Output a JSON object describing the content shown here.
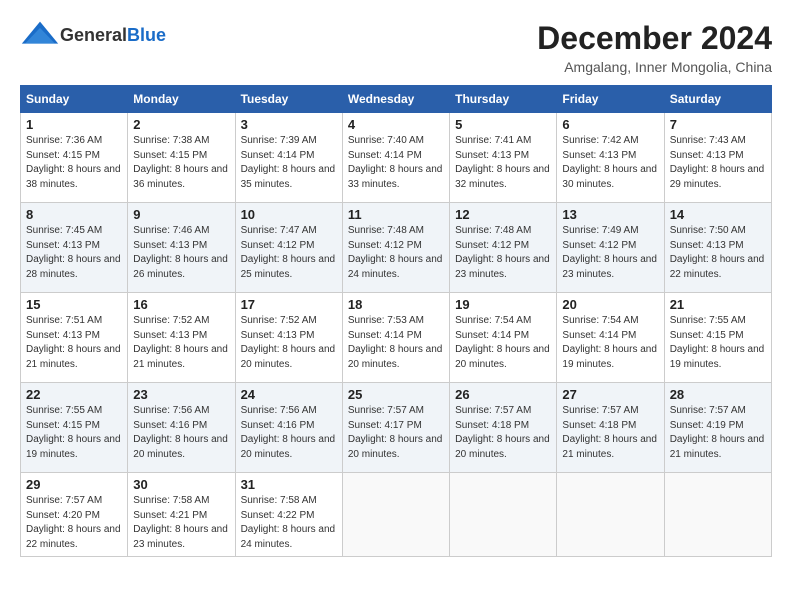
{
  "header": {
    "logo_general": "General",
    "logo_blue": "Blue",
    "month": "December 2024",
    "location": "Amgalang, Inner Mongolia, China"
  },
  "days_of_week": [
    "Sunday",
    "Monday",
    "Tuesday",
    "Wednesday",
    "Thursday",
    "Friday",
    "Saturday"
  ],
  "weeks": [
    [
      {
        "day": "1",
        "sunrise": "7:36 AM",
        "sunset": "4:15 PM",
        "daylight": "8 hours and 38 minutes."
      },
      {
        "day": "2",
        "sunrise": "7:38 AM",
        "sunset": "4:15 PM",
        "daylight": "8 hours and 36 minutes."
      },
      {
        "day": "3",
        "sunrise": "7:39 AM",
        "sunset": "4:14 PM",
        "daylight": "8 hours and 35 minutes."
      },
      {
        "day": "4",
        "sunrise": "7:40 AM",
        "sunset": "4:14 PM",
        "daylight": "8 hours and 33 minutes."
      },
      {
        "day": "5",
        "sunrise": "7:41 AM",
        "sunset": "4:13 PM",
        "daylight": "8 hours and 32 minutes."
      },
      {
        "day": "6",
        "sunrise": "7:42 AM",
        "sunset": "4:13 PM",
        "daylight": "8 hours and 30 minutes."
      },
      {
        "day": "7",
        "sunrise": "7:43 AM",
        "sunset": "4:13 PM",
        "daylight": "8 hours and 29 minutes."
      }
    ],
    [
      {
        "day": "8",
        "sunrise": "7:45 AM",
        "sunset": "4:13 PM",
        "daylight": "8 hours and 28 minutes."
      },
      {
        "day": "9",
        "sunrise": "7:46 AM",
        "sunset": "4:13 PM",
        "daylight": "8 hours and 26 minutes."
      },
      {
        "day": "10",
        "sunrise": "7:47 AM",
        "sunset": "4:12 PM",
        "daylight": "8 hours and 25 minutes."
      },
      {
        "day": "11",
        "sunrise": "7:48 AM",
        "sunset": "4:12 PM",
        "daylight": "8 hours and 24 minutes."
      },
      {
        "day": "12",
        "sunrise": "7:48 AM",
        "sunset": "4:12 PM",
        "daylight": "8 hours and 23 minutes."
      },
      {
        "day": "13",
        "sunrise": "7:49 AM",
        "sunset": "4:12 PM",
        "daylight": "8 hours and 23 minutes."
      },
      {
        "day": "14",
        "sunrise": "7:50 AM",
        "sunset": "4:13 PM",
        "daylight": "8 hours and 22 minutes."
      }
    ],
    [
      {
        "day": "15",
        "sunrise": "7:51 AM",
        "sunset": "4:13 PM",
        "daylight": "8 hours and 21 minutes."
      },
      {
        "day": "16",
        "sunrise": "7:52 AM",
        "sunset": "4:13 PM",
        "daylight": "8 hours and 21 minutes."
      },
      {
        "day": "17",
        "sunrise": "7:52 AM",
        "sunset": "4:13 PM",
        "daylight": "8 hours and 20 minutes."
      },
      {
        "day": "18",
        "sunrise": "7:53 AM",
        "sunset": "4:14 PM",
        "daylight": "8 hours and 20 minutes."
      },
      {
        "day": "19",
        "sunrise": "7:54 AM",
        "sunset": "4:14 PM",
        "daylight": "8 hours and 20 minutes."
      },
      {
        "day": "20",
        "sunrise": "7:54 AM",
        "sunset": "4:14 PM",
        "daylight": "8 hours and 19 minutes."
      },
      {
        "day": "21",
        "sunrise": "7:55 AM",
        "sunset": "4:15 PM",
        "daylight": "8 hours and 19 minutes."
      }
    ],
    [
      {
        "day": "22",
        "sunrise": "7:55 AM",
        "sunset": "4:15 PM",
        "daylight": "8 hours and 19 minutes."
      },
      {
        "day": "23",
        "sunrise": "7:56 AM",
        "sunset": "4:16 PM",
        "daylight": "8 hours and 20 minutes."
      },
      {
        "day": "24",
        "sunrise": "7:56 AM",
        "sunset": "4:16 PM",
        "daylight": "8 hours and 20 minutes."
      },
      {
        "day": "25",
        "sunrise": "7:57 AM",
        "sunset": "4:17 PM",
        "daylight": "8 hours and 20 minutes."
      },
      {
        "day": "26",
        "sunrise": "7:57 AM",
        "sunset": "4:18 PM",
        "daylight": "8 hours and 20 minutes."
      },
      {
        "day": "27",
        "sunrise": "7:57 AM",
        "sunset": "4:18 PM",
        "daylight": "8 hours and 21 minutes."
      },
      {
        "day": "28",
        "sunrise": "7:57 AM",
        "sunset": "4:19 PM",
        "daylight": "8 hours and 21 minutes."
      }
    ],
    [
      {
        "day": "29",
        "sunrise": "7:57 AM",
        "sunset": "4:20 PM",
        "daylight": "8 hours and 22 minutes."
      },
      {
        "day": "30",
        "sunrise": "7:58 AM",
        "sunset": "4:21 PM",
        "daylight": "8 hours and 23 minutes."
      },
      {
        "day": "31",
        "sunrise": "7:58 AM",
        "sunset": "4:22 PM",
        "daylight": "8 hours and 24 minutes."
      },
      null,
      null,
      null,
      null
    ]
  ]
}
